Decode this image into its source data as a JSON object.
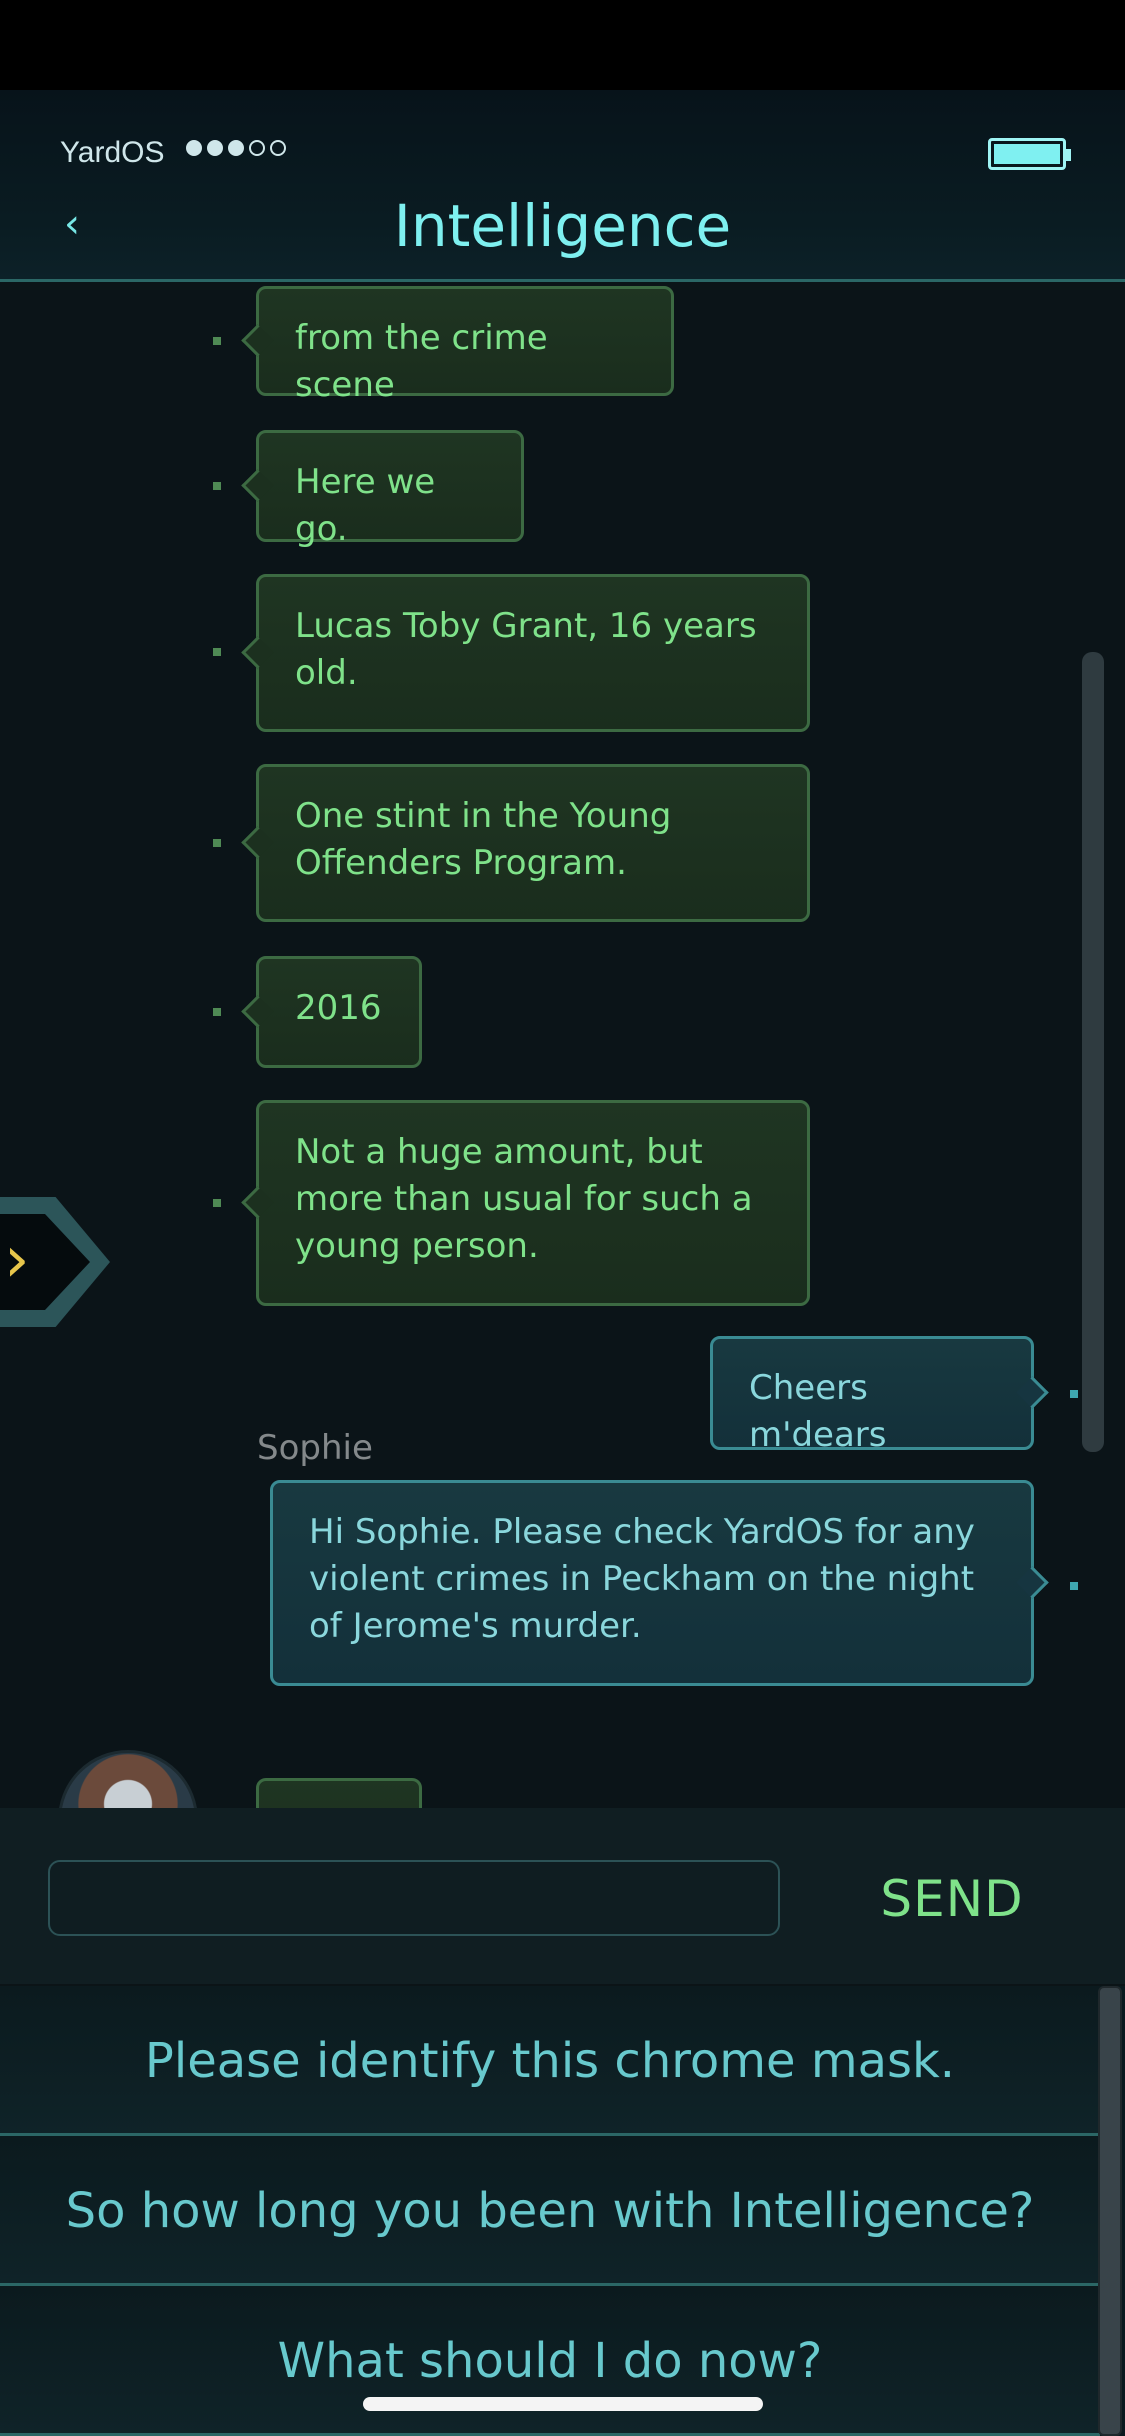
{
  "status_bar": {
    "carrier": "YardOS",
    "signal_bars": 3,
    "signal_total": 5,
    "battery_level": 1.0
  },
  "header": {
    "title": "Intelligence",
    "back_icon": "chevron-left-icon"
  },
  "messages": [
    {
      "text": "from the crime scene",
      "direction": "incoming"
    },
    {
      "text": "Here we go.",
      "direction": "incoming"
    },
    {
      "text": "Lucas Toby Grant, 16 years old.",
      "direction": "incoming"
    },
    {
      "text": "One stint in the Young Offenders Program.",
      "direction": "incoming"
    },
    {
      "text": "2016",
      "direction": "incoming"
    },
    {
      "text": "Not a huge amount, but more than usual for such a young person.",
      "direction": "incoming"
    },
    {
      "text": "Cheers m'dears",
      "direction": "outgoing"
    },
    {
      "text": "Hi Sophie. Please check YardOS for any violent crimes in Peckham on the night of Jerome's murder.",
      "direction": "outgoing"
    }
  ],
  "next_sender": {
    "name": "Sophie"
  },
  "side_tab": {
    "icon": "chevron-right-icon"
  },
  "composer": {
    "value": "",
    "send_label": "SEND"
  },
  "reply_options": [
    "Please identify this chrome mask.",
    "So how long you been with Intelligence?",
    "What should I do now?"
  ],
  "colors": {
    "incoming_text": "#7fe28a",
    "outgoing_text": "#8ad7dc",
    "title": "#7ef0f0",
    "accent": "#e7c64b"
  }
}
